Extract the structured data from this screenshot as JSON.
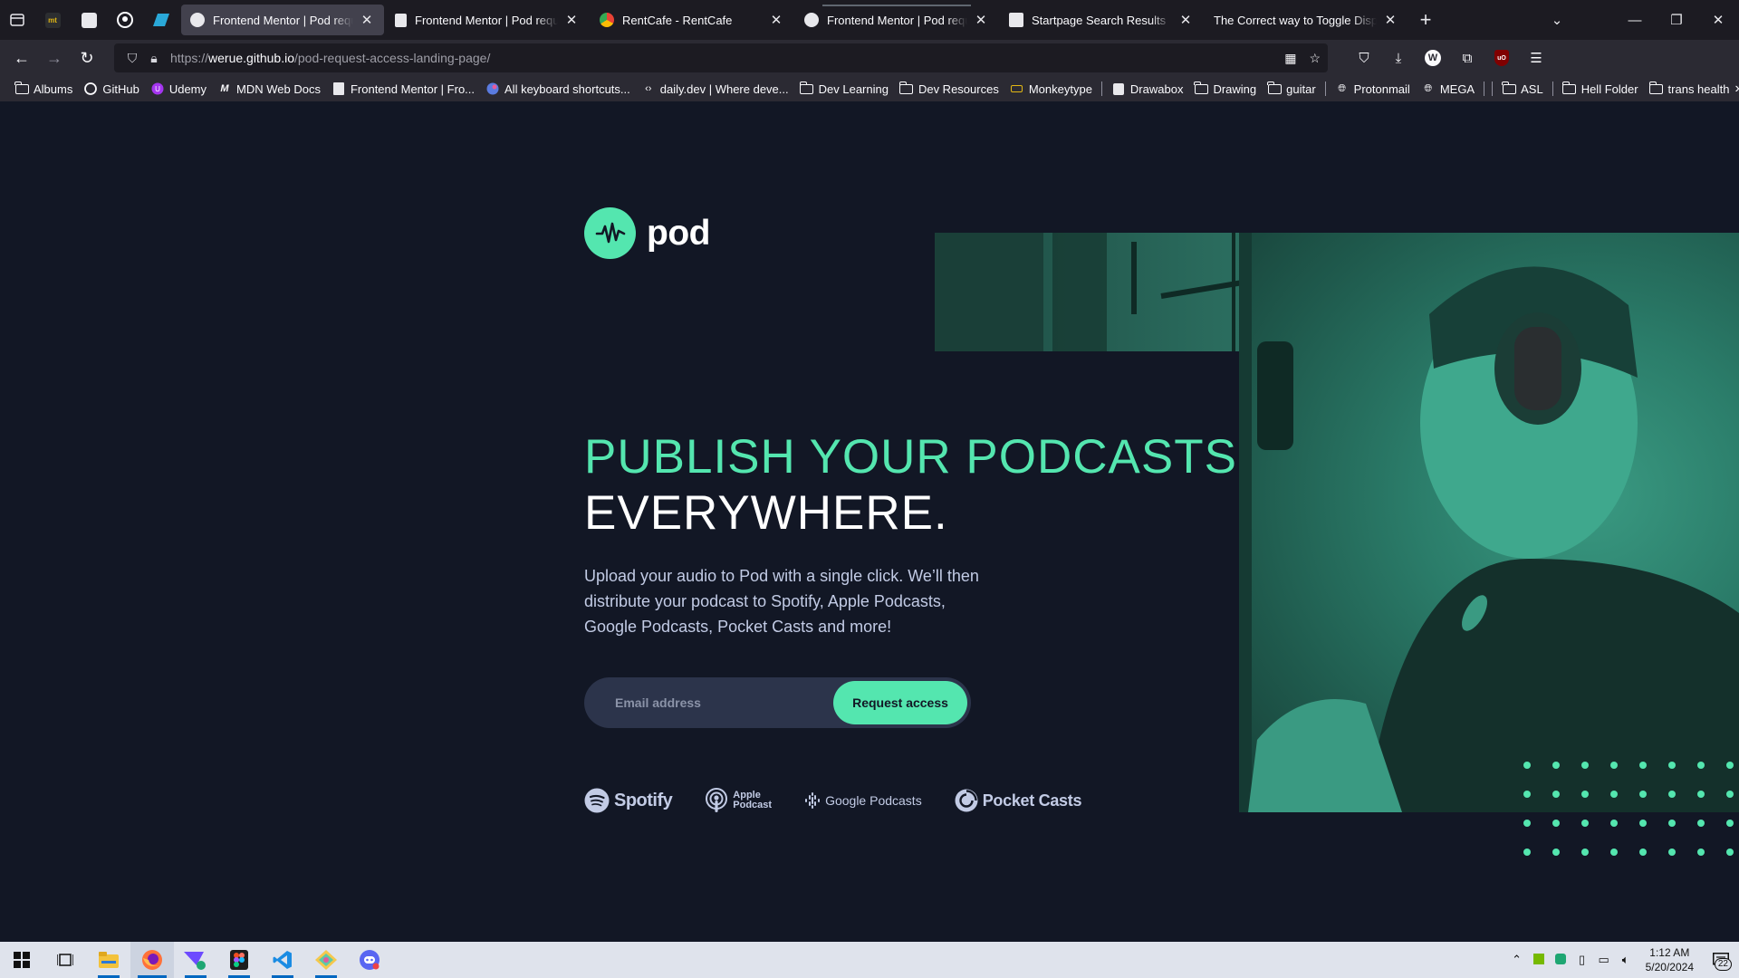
{
  "browser": {
    "tabs": [
      {
        "label": "Frontend Mentor | Pod request access landing page",
        "active": true,
        "closable": true
      },
      {
        "label": "Frontend Mentor | Pod request access landing page",
        "active": false,
        "closable": true
      },
      {
        "label": "RentCafe - RentCafe",
        "active": false,
        "closable": true
      },
      {
        "label": "Frontend Mentor | Pod request access landing page",
        "active": false,
        "closable": true
      },
      {
        "label": "Startpage Search Results",
        "active": false,
        "closable": true
      },
      {
        "label": "The Correct way to Toggle Display with JavaScript",
        "active": false,
        "closable": true
      }
    ],
    "url": {
      "scheme": "https://",
      "host": "werue.github.io",
      "path": "/pod-request-access-landing-page/"
    },
    "bookmarks": [
      {
        "label": "Albums",
        "icon": "folder-icon"
      },
      {
        "label": "GitHub",
        "icon": "github-icon"
      },
      {
        "label": "Udemy",
        "icon": "udemy-icon"
      },
      {
        "label": "MDN Web Docs",
        "icon": "mdn-icon"
      },
      {
        "label": "Frontend Mentor | Fro...",
        "icon": "frontend-mentor-icon"
      },
      {
        "label": "All keyboard shortcuts...",
        "icon": "keyboard-icon"
      },
      {
        "label": "daily.dev | Where deve...",
        "icon": "dailydev-icon"
      },
      {
        "label": "Dev Learning",
        "icon": "folder-icon"
      },
      {
        "label": "Dev Resources",
        "icon": "folder-icon"
      },
      {
        "label": "Monkeytype",
        "icon": "monkeytype-icon"
      },
      {
        "label": "Drawabox",
        "icon": "drawabox-icon"
      },
      {
        "label": "Drawing",
        "icon": "folder-icon"
      },
      {
        "label": "guitar",
        "icon": "folder-icon"
      },
      {
        "label": "Protonmail",
        "icon": "globe-icon"
      },
      {
        "label": "MEGA",
        "icon": "globe-icon"
      },
      {
        "label": "ASL",
        "icon": "folder-icon"
      },
      {
        "label": "Hell Folder",
        "icon": "folder-icon"
      },
      {
        "label": "trans health",
        "icon": "folder-icon"
      }
    ]
  },
  "page": {
    "logo_text": "pod",
    "headline_accent": "PUBLISH YOUR PODCASTS",
    "headline_white": "EVERYWHERE.",
    "description": "Upload your audio to Pod with a single click. We’ll then distribute your podcast to Spotify, Apple Podcasts, Google Podcasts, Pocket Casts and more!",
    "email_placeholder": "Email address",
    "email_value": "",
    "request_button": "Request access",
    "platforms": {
      "spotify": "Spotify",
      "apple_line1": "Apple",
      "apple_line2": "Podcast",
      "google": "Google Podcasts",
      "pocket": "Pocket Casts"
    },
    "colors": {
      "background": "#121725",
      "accent": "#54e6af",
      "input_bg": "#2c344b",
      "text_muted": "#c2cbe5"
    }
  },
  "taskbar": {
    "clock_time": "1:12 AM",
    "clock_date": "5/20/2024",
    "notification_count": "22",
    "apps": [
      "windows-start-icon",
      "task-view-icon",
      "file-explorer-icon",
      "firefox-icon",
      "proton-vpn-icon",
      "figma-icon",
      "vscode-icon",
      "gitkraken-icon",
      "discord-icon"
    ]
  }
}
